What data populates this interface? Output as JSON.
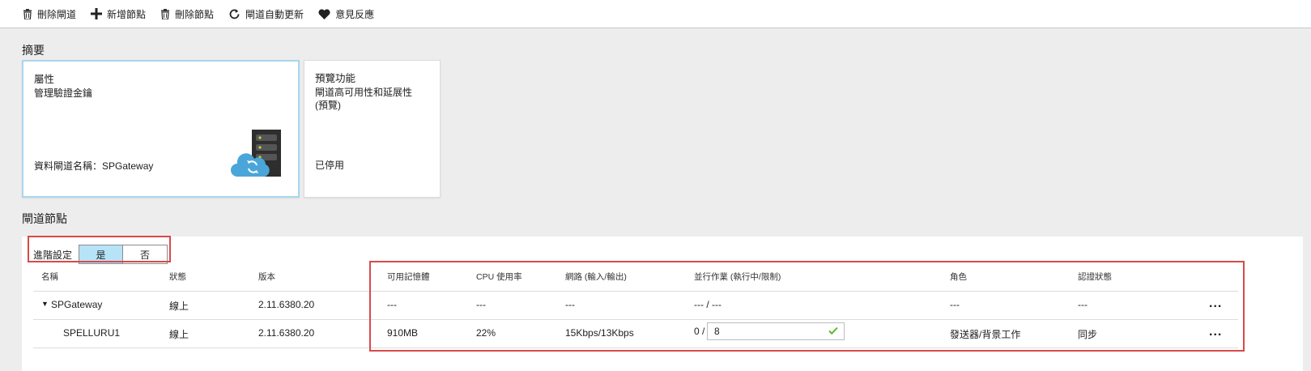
{
  "toolbar": {
    "delete_gateway": "刪除閘道",
    "add_node": "新增節點",
    "delete_node": "刪除節點",
    "auto_update": "閘道自動更新",
    "feedback": "意見反應"
  },
  "summary": {
    "title": "摘要",
    "properties_tile": {
      "title": "屬性",
      "subtitle": "管理驗證金鑰",
      "footer": "資料閘道名稱：SPGateway"
    },
    "preview_tile": {
      "title": "預覽功能",
      "subtitle": "閘道高可用性和延展性",
      "subtitle2": "(預覽)",
      "footer": "已停用"
    }
  },
  "nodes": {
    "title": "閘道節點",
    "advanced_label": "進階設定",
    "toggle_yes": "是",
    "toggle_no": "否",
    "columns": {
      "name": "名稱",
      "status": "狀態",
      "version": "版本",
      "memory": "可用記憶體",
      "cpu": "CPU 使用率",
      "network": "網路 (輸入/輸出)",
      "jobs": "並行作業 (執行中/限制)",
      "role": "角色",
      "auth": "認證狀態"
    },
    "rows": [
      {
        "name": "SPGateway",
        "status": "線上",
        "version": "2.11.6380.20",
        "memory": "---",
        "cpu": "---",
        "network": "---",
        "jobs": "--- / ---",
        "role": "---",
        "auth": "---",
        "more": "..."
      },
      {
        "name": "SPELLURU1",
        "status": "線上",
        "version": "2.11.6380.20",
        "memory": "910MB",
        "cpu": "22%",
        "network": "15Kbps/13Kbps",
        "jobs_running": "0 /",
        "jobs_limit": "8",
        "role": "發送器/背景工作",
        "auth": "同步",
        "more": "..."
      }
    ]
  },
  "colors": {
    "highlight_border": "#d84a4a",
    "toggle_on": "#b6e3f7",
    "check": "#5cb82a",
    "cloud": "#4aa6d9"
  }
}
